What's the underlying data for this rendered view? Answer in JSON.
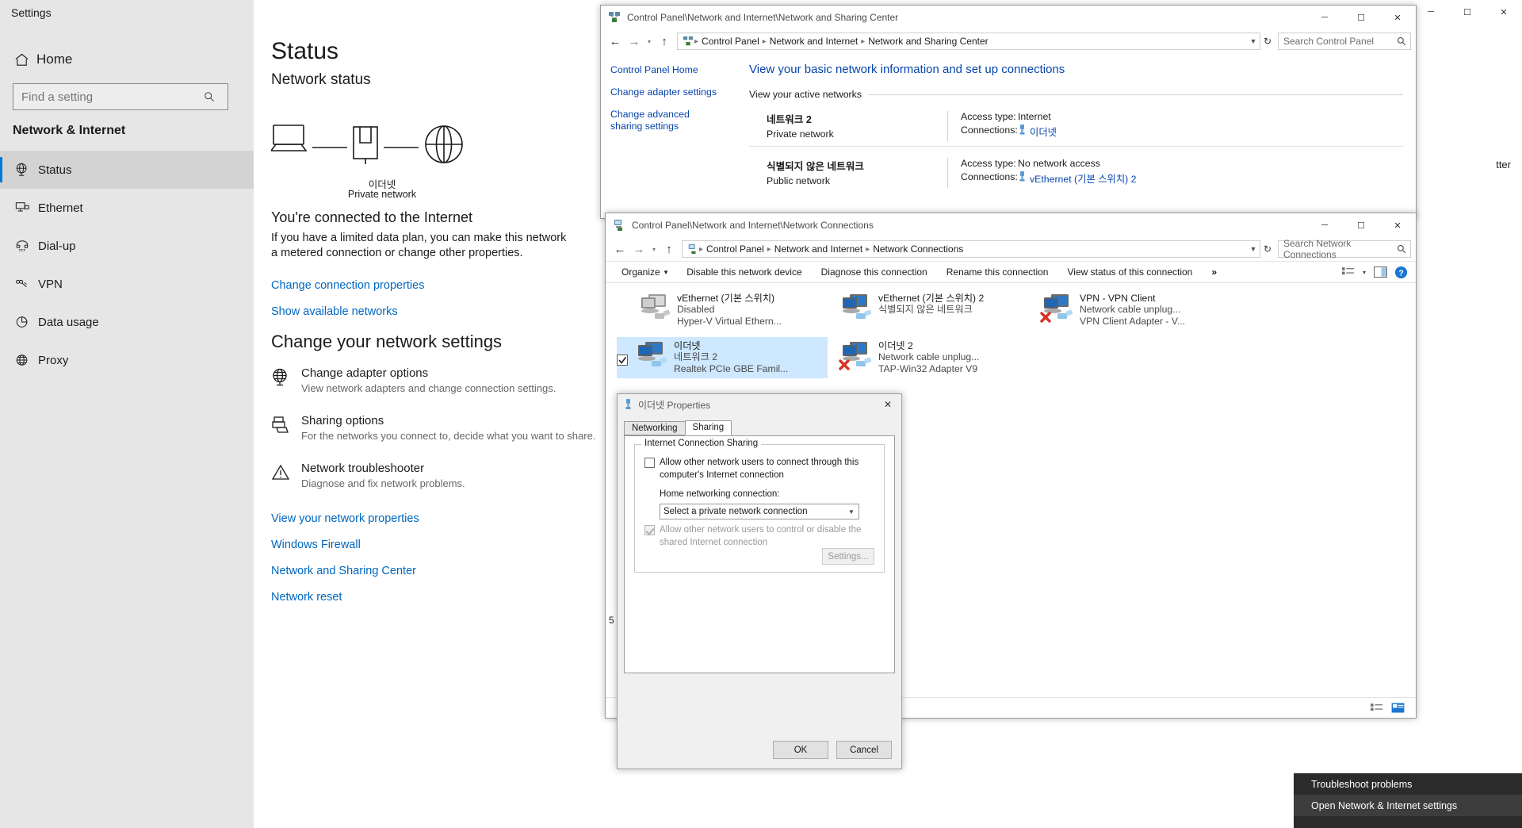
{
  "settings": {
    "window_title": "Settings",
    "home_label": "Home",
    "search": {
      "placeholder": "Find a setting",
      "value": ""
    },
    "section_title": "Network & Internet",
    "nav_items": [
      {
        "label": "Status",
        "icon": "globe-status-icon",
        "active": true
      },
      {
        "label": "Ethernet",
        "icon": "ethernet-icon",
        "active": false
      },
      {
        "label": "Dial-up",
        "icon": "dialup-icon",
        "active": false
      },
      {
        "label": "VPN",
        "icon": "vpn-icon",
        "active": false
      },
      {
        "label": "Data usage",
        "icon": "pie-chart-icon",
        "active": false
      },
      {
        "label": "Proxy",
        "icon": "globe-icon",
        "active": false
      }
    ],
    "page_title": "Status",
    "network_status_heading": "Network status",
    "diagram": {
      "device_icon": "laptop-icon",
      "network_icon": "network-adapter-icon",
      "internet_icon": "globe-icon",
      "network_name": "이더넷",
      "network_type": "Private network"
    },
    "connected_heading": "You're connected to the Internet",
    "connected_sub": "If you have a limited data plan, you can make this network a metered connection or change other properties.",
    "link_change_connection": "Change connection properties",
    "link_show_networks": "Show available networks",
    "change_settings_heading": "Change your network settings",
    "tiles": [
      {
        "icon": "globe-adapter-icon",
        "title": "Change adapter options",
        "desc": "View network adapters and change connection settings."
      },
      {
        "icon": "sharing-icon",
        "title": "Sharing options",
        "desc": "For the networks you connect to, decide what you want to share."
      },
      {
        "icon": "warning-triangle-icon",
        "title": "Network troubleshooter",
        "desc": "Diagnose and fix network problems."
      }
    ],
    "bottom_links": [
      "View your network properties",
      "Windows Firewall",
      "Network and Sharing Center",
      "Network reset"
    ]
  },
  "sharing_center": {
    "window_title": "Control Panel\\Network and Internet\\Network and Sharing Center",
    "window_icon": "network-sharing-icon",
    "titlebar_buttons": {
      "minimize": "─",
      "maximize": "☐",
      "close": "✕"
    },
    "breadcrumbs": [
      "Control Panel",
      "Network and Internet",
      "Network and Sharing Center"
    ],
    "address_dropdown_icon": "chevron-down-icon",
    "refresh_icon": "refresh-icon",
    "search": {
      "placeholder": "Search Control Panel",
      "value": ""
    },
    "left_links": [
      "Control Panel Home",
      "Change adapter settings",
      "Change advanced sharing settings"
    ],
    "main_heading": "View your basic network information and set up connections",
    "active_networks_heading": "View your active networks",
    "networks": [
      {
        "name": "네트워크 2",
        "type": "Private network",
        "access_type_label": "Access type:",
        "access_type_value": "Internet",
        "connections_label": "Connections:",
        "connection_name": "이더넷",
        "connection_icon": "ethernet-plug-icon"
      },
      {
        "name": "식별되지 않은 네트워크",
        "type": "Public network",
        "access_type_label": "Access type:",
        "access_type_value": "No network access",
        "connections_label": "Connections:",
        "connection_name": "vEthernet (기본 스위치) 2",
        "connection_icon": "ethernet-plug-icon"
      }
    ]
  },
  "connections_window": {
    "window_title": "Control Panel\\Network and Internet\\Network Connections",
    "window_icon": "network-connections-icon",
    "titlebar_buttons": {
      "minimize": "─",
      "maximize": "☐",
      "close": "✕"
    },
    "breadcrumbs": [
      "Control Panel",
      "Network and Internet",
      "Network Connections"
    ],
    "search": {
      "placeholder": "Search Network Connections",
      "value": ""
    },
    "toolbar": {
      "organize": "Organize",
      "organize_caret": "▾",
      "disable": "Disable this network device",
      "diagnose": "Diagnose this connection",
      "rename": "Rename this connection",
      "view_status": "View status of this connection",
      "overflow": "»",
      "view_icon": "view-options-icon",
      "view_caret": "▾",
      "preview_pane_icon": "preview-pane-icon",
      "help_icon": "help-icon"
    },
    "status_text": "5",
    "statusbar_icons": [
      "details-view-icon",
      "tiles-view-icon"
    ],
    "adapters": [
      {
        "name": "vEthernet (기본 스위치)",
        "line2": "Disabled",
        "line3": "Hyper-V Virtual Ethern...",
        "state": "disabled",
        "selected": false,
        "checkbox": false,
        "error_badge": false
      },
      {
        "name": "vEthernet (기본 스위치) 2",
        "line2": "",
        "line3": "식별되지 않은 네트워크",
        "state": "active",
        "selected": false,
        "checkbox": false,
        "error_badge": false
      },
      {
        "name": "VPN - VPN Client",
        "line2": "Network cable unplug...",
        "line3": "VPN Client Adapter - V...",
        "state": "active",
        "selected": false,
        "checkbox": false,
        "error_badge": true
      },
      {
        "name": "이더넷",
        "line2": "네트워크 2",
        "line3": "Realtek PCIe GBE Famil...",
        "state": "active",
        "selected": true,
        "checkbox": true,
        "error_badge": false
      },
      {
        "name": "이더넷 2",
        "line2": "Network cable unplug...",
        "line3": "TAP-Win32 Adapter V9",
        "state": "active",
        "selected": false,
        "checkbox": false,
        "error_badge": true
      }
    ]
  },
  "properties_dialog": {
    "title": "이더넷 Properties",
    "title_icon": "ethernet-plug-icon",
    "close_label": "✕",
    "tabs": [
      {
        "label": "Networking",
        "active": false
      },
      {
        "label": "Sharing",
        "active": true
      }
    ],
    "group_label": "Internet Connection Sharing",
    "allow_connect_checkbox": {
      "checked": false,
      "line1": "Allow other network users to connect through this",
      "line2": "computer's Internet connection"
    },
    "home_networking_label": "Home networking connection:",
    "home_networking_value": "Select a private network connection",
    "home_networking_caret": "⌄",
    "allow_control_checkbox": {
      "checked": true,
      "disabled": true,
      "line1": "Allow other network users to control or disable the",
      "line2": "shared Internet connection"
    },
    "settings_button": "Settings...",
    "ok_button": "OK",
    "cancel_button": "Cancel"
  },
  "context_menu": {
    "items": [
      {
        "label": "Troubleshoot problems",
        "highlighted": false
      },
      {
        "label": "Open Network & Internet settings",
        "highlighted": true
      }
    ]
  },
  "desktop_window_fragment": {
    "buttons": {
      "minimize": "─",
      "maximize": "☐",
      "close": "✕"
    },
    "text": "tter"
  }
}
